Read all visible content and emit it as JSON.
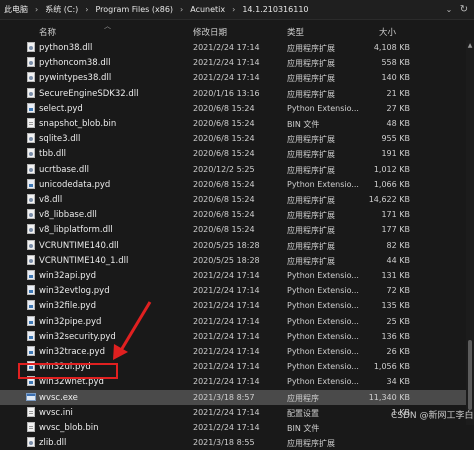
{
  "breadcrumb": {
    "items": [
      "此电脑",
      "系统 (C:)",
      "Program Files (x86)",
      "Acunetix",
      "14.1.210316110"
    ],
    "separator": "›"
  },
  "columns": {
    "name": "名称",
    "date": "修改日期",
    "type": "类型",
    "size": "大小"
  },
  "files": [
    {
      "name": "python38.dll",
      "date": "2021/2/24 17:14",
      "type": "应用程序扩展",
      "size": "4,108 KB",
      "icon": "dll-file-icon"
    },
    {
      "name": "pythoncom38.dll",
      "date": "2021/2/24 17:14",
      "type": "应用程序扩展",
      "size": "558 KB",
      "icon": "dll-file-icon"
    },
    {
      "name": "pywintypes38.dll",
      "date": "2021/2/24 17:14",
      "type": "应用程序扩展",
      "size": "140 KB",
      "icon": "dll-file-icon"
    },
    {
      "name": "SecureEngineSDK32.dll",
      "date": "2020/1/16 13:16",
      "type": "应用程序扩展",
      "size": "21 KB",
      "icon": "dll-file-icon"
    },
    {
      "name": "select.pyd",
      "date": "2020/6/8 15:24",
      "type": "Python Extensio...",
      "size": "27 KB",
      "icon": "python-file-icon"
    },
    {
      "name": "snapshot_blob.bin",
      "date": "2020/6/8 15:24",
      "type": "BIN 文件",
      "size": "48 KB",
      "icon": "bin-file-icon"
    },
    {
      "name": "sqlite3.dll",
      "date": "2020/6/8 15:24",
      "type": "应用程序扩展",
      "size": "955 KB",
      "icon": "dll-file-icon"
    },
    {
      "name": "tbb.dll",
      "date": "2020/6/8 15:24",
      "type": "应用程序扩展",
      "size": "191 KB",
      "icon": "dll-file-icon"
    },
    {
      "name": "ucrtbase.dll",
      "date": "2020/12/2 5:25",
      "type": "应用程序扩展",
      "size": "1,012 KB",
      "icon": "dll-file-icon"
    },
    {
      "name": "unicodedata.pyd",
      "date": "2020/6/8 15:24",
      "type": "Python Extensio...",
      "size": "1,066 KB",
      "icon": "python-file-icon"
    },
    {
      "name": "v8.dll",
      "date": "2020/6/8 15:24",
      "type": "应用程序扩展",
      "size": "14,622 KB",
      "icon": "dll-file-icon"
    },
    {
      "name": "v8_libbase.dll",
      "date": "2020/6/8 15:24",
      "type": "应用程序扩展",
      "size": "171 KB",
      "icon": "dll-file-icon"
    },
    {
      "name": "v8_libplatform.dll",
      "date": "2020/6/8 15:24",
      "type": "应用程序扩展",
      "size": "177 KB",
      "icon": "dll-file-icon"
    },
    {
      "name": "VCRUNTIME140.dll",
      "date": "2020/5/25 18:28",
      "type": "应用程序扩展",
      "size": "82 KB",
      "icon": "dll-file-icon"
    },
    {
      "name": "VCRUNTIME140_1.dll",
      "date": "2020/5/25 18:28",
      "type": "应用程序扩展",
      "size": "44 KB",
      "icon": "dll-file-icon"
    },
    {
      "name": "win32api.pyd",
      "date": "2021/2/24 17:14",
      "type": "Python Extensio...",
      "size": "131 KB",
      "icon": "python-file-icon"
    },
    {
      "name": "win32evtlog.pyd",
      "date": "2021/2/24 17:14",
      "type": "Python Extensio...",
      "size": "72 KB",
      "icon": "python-file-icon"
    },
    {
      "name": "win32file.pyd",
      "date": "2021/2/24 17:14",
      "type": "Python Extensio...",
      "size": "135 KB",
      "icon": "python-file-icon"
    },
    {
      "name": "win32pipe.pyd",
      "date": "2021/2/24 17:14",
      "type": "Python Extensio...",
      "size": "25 KB",
      "icon": "python-file-icon"
    },
    {
      "name": "win32security.pyd",
      "date": "2021/2/24 17:14",
      "type": "Python Extensio...",
      "size": "136 KB",
      "icon": "python-file-icon"
    },
    {
      "name": "win32trace.pyd",
      "date": "2021/2/24 17:14",
      "type": "Python Extensio...",
      "size": "26 KB",
      "icon": "python-file-icon"
    },
    {
      "name": "win32ui.pyd",
      "date": "2021/2/24 17:14",
      "type": "Python Extensio...",
      "size": "1,056 KB",
      "icon": "python-file-icon"
    },
    {
      "name": "win32wnet.pyd",
      "date": "2021/2/24 17:14",
      "type": "Python Extensio...",
      "size": "34 KB",
      "icon": "python-file-icon"
    },
    {
      "name": "wvsc.exe",
      "date": "2021/3/18 8:57",
      "type": "应用程序",
      "size": "11,340 KB",
      "icon": "exe-file-icon",
      "selected": true
    },
    {
      "name": "wvsc.ini",
      "date": "2021/2/24 17:14",
      "type": "配置设置",
      "size": "1 KB",
      "icon": "ini-file-icon"
    },
    {
      "name": "wvsc_blob.bin",
      "date": "2021/2/24 17:14",
      "type": "BIN 文件",
      "size": "",
      "icon": "bin-file-icon"
    },
    {
      "name": "zlib.dll",
      "date": "2021/3/18 8:55",
      "type": "应用程序扩展",
      "size": "",
      "icon": "dll-file-icon"
    }
  ],
  "annotation": {
    "color": "#e02020"
  },
  "watermark": "CSDN @新网工李白"
}
